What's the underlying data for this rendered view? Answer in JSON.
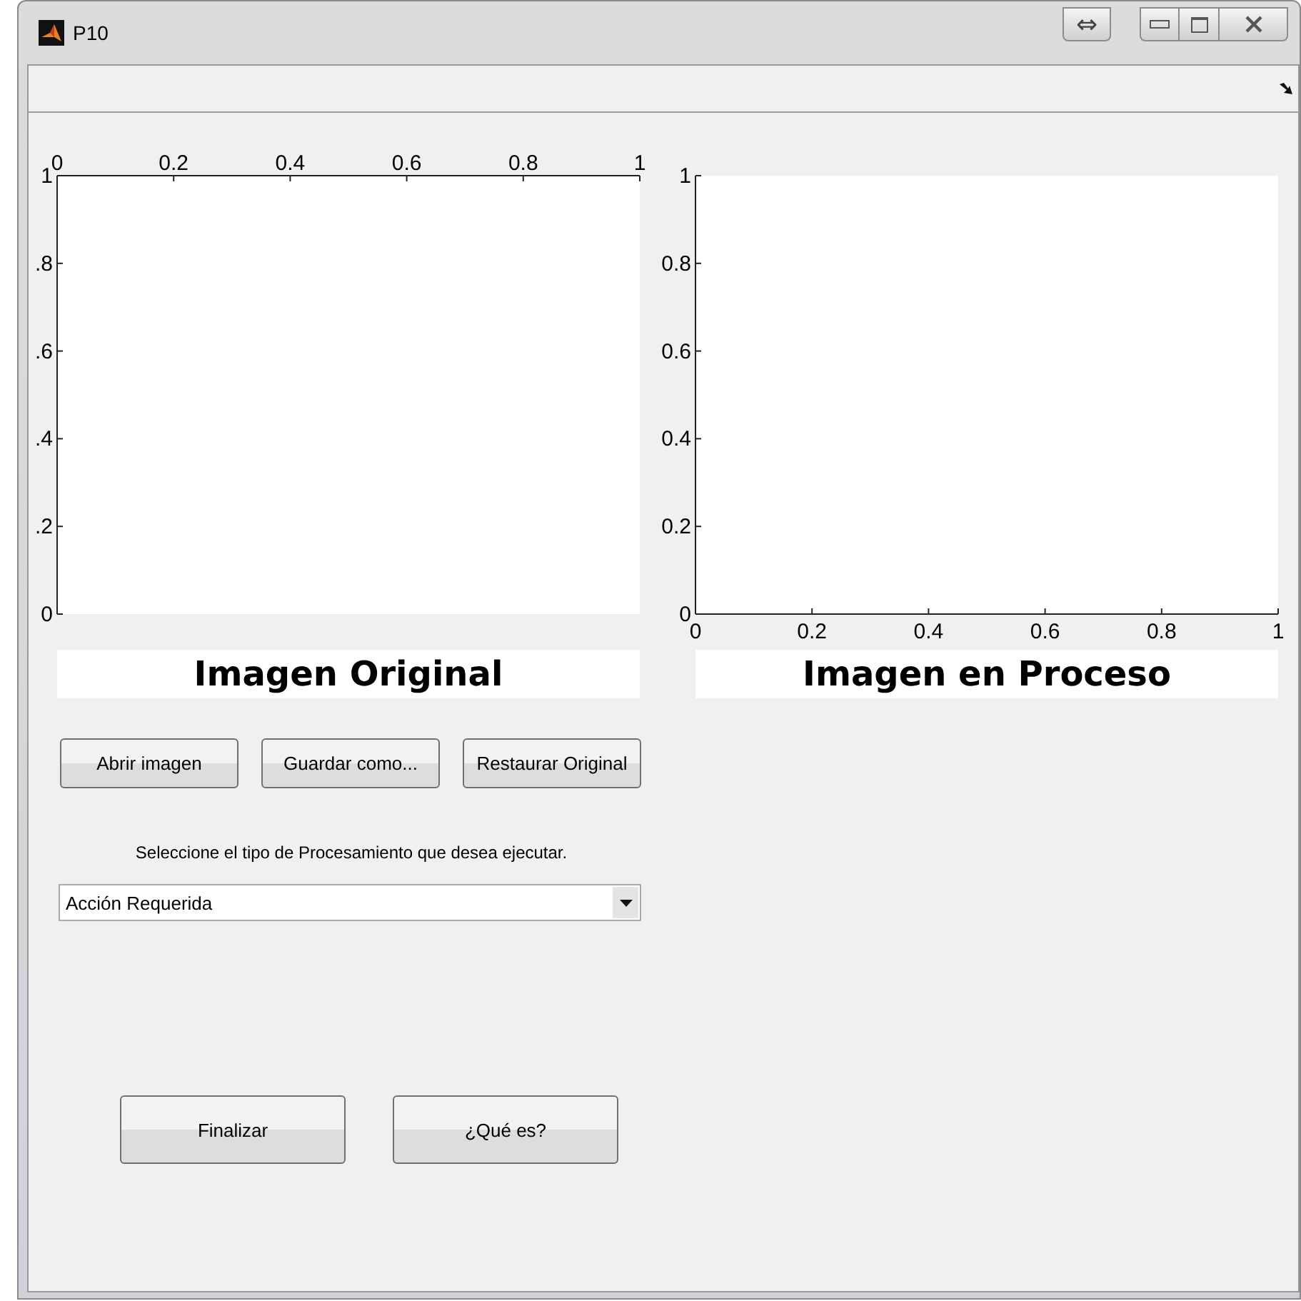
{
  "window": {
    "title": "P10"
  },
  "title_bar_buttons": [
    {
      "kind": "dock",
      "label": "⇔"
    },
    {
      "kind": "minimize"
    },
    {
      "kind": "maximize"
    },
    {
      "kind": "close"
    }
  ],
  "axes": [
    {
      "kind": "x-axis-top",
      "caption": "Imagen Original",
      "chart_data": {
        "type": "line",
        "xlim": [
          0,
          1
        ],
        "ylim": [
          0,
          1
        ],
        "xticks": [
          0,
          0.2,
          0.4,
          0.6,
          0.8,
          1
        ],
        "yticks": [
          {
            "value": 0,
            "label": "0"
          },
          {
            "value": 0.2,
            "label": ".2"
          },
          {
            "value": 0.4,
            "label": ".4"
          },
          {
            "value": 0.6,
            "label": ".6"
          },
          {
            "value": 0.8,
            "label": ".8"
          },
          {
            "value": 1,
            "label": "1"
          }
        ]
      }
    },
    {
      "kind": "x-axis-bottom",
      "caption": "Imagen en Proceso",
      "chart_data": {
        "type": "line",
        "xlim": [
          0,
          1
        ],
        "ylim": [
          0,
          1
        ],
        "xticks": [
          0,
          0.2,
          0.4,
          0.6,
          0.8,
          1
        ],
        "yticks": [
          0,
          0.2,
          0.4,
          0.6,
          0.8,
          1
        ]
      }
    }
  ],
  "buttons": [
    "Abrir imagen",
    "Guardar como...",
    "Restaurar Original"
  ],
  "prompt": "Seleccione el tipo de Procesamiento que desea ejecutar.",
  "dropdown": {
    "value": "Acción Requerida"
  },
  "bottom_buttons": [
    "Finalizar",
    "¿Qué es?"
  ]
}
